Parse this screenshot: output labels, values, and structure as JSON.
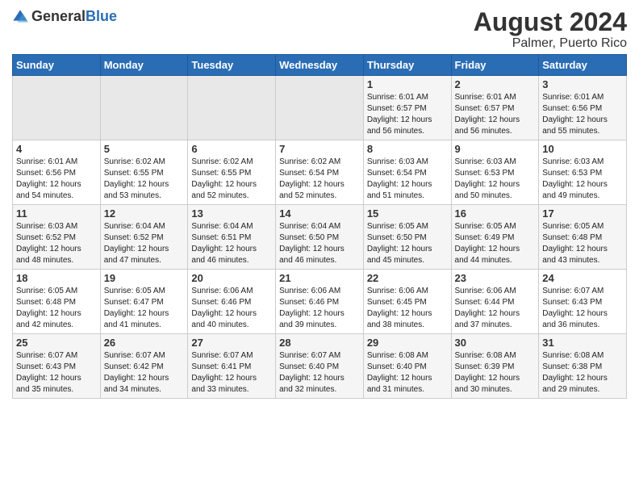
{
  "logo": {
    "general": "General",
    "blue": "Blue"
  },
  "title": "August 2024",
  "subtitle": "Palmer, Puerto Rico",
  "days_header": [
    "Sunday",
    "Monday",
    "Tuesday",
    "Wednesday",
    "Thursday",
    "Friday",
    "Saturday"
  ],
  "weeks": [
    [
      {
        "day": "",
        "sunrise": "",
        "sunset": "",
        "daylight": "",
        "empty": true
      },
      {
        "day": "",
        "sunrise": "",
        "sunset": "",
        "daylight": "",
        "empty": true
      },
      {
        "day": "",
        "sunrise": "",
        "sunset": "",
        "daylight": "",
        "empty": true
      },
      {
        "day": "",
        "sunrise": "",
        "sunset": "",
        "daylight": "",
        "empty": true
      },
      {
        "day": "1",
        "sunrise": "Sunrise: 6:01 AM",
        "sunset": "Sunset: 6:57 PM",
        "daylight": "Daylight: 12 hours and 56 minutes.",
        "empty": false
      },
      {
        "day": "2",
        "sunrise": "Sunrise: 6:01 AM",
        "sunset": "Sunset: 6:57 PM",
        "daylight": "Daylight: 12 hours and 56 minutes.",
        "empty": false
      },
      {
        "day": "3",
        "sunrise": "Sunrise: 6:01 AM",
        "sunset": "Sunset: 6:56 PM",
        "daylight": "Daylight: 12 hours and 55 minutes.",
        "empty": false
      }
    ],
    [
      {
        "day": "4",
        "sunrise": "Sunrise: 6:01 AM",
        "sunset": "Sunset: 6:56 PM",
        "daylight": "Daylight: 12 hours and 54 minutes.",
        "empty": false
      },
      {
        "day": "5",
        "sunrise": "Sunrise: 6:02 AM",
        "sunset": "Sunset: 6:55 PM",
        "daylight": "Daylight: 12 hours and 53 minutes.",
        "empty": false
      },
      {
        "day": "6",
        "sunrise": "Sunrise: 6:02 AM",
        "sunset": "Sunset: 6:55 PM",
        "daylight": "Daylight: 12 hours and 52 minutes.",
        "empty": false
      },
      {
        "day": "7",
        "sunrise": "Sunrise: 6:02 AM",
        "sunset": "Sunset: 6:54 PM",
        "daylight": "Daylight: 12 hours and 52 minutes.",
        "empty": false
      },
      {
        "day": "8",
        "sunrise": "Sunrise: 6:03 AM",
        "sunset": "Sunset: 6:54 PM",
        "daylight": "Daylight: 12 hours and 51 minutes.",
        "empty": false
      },
      {
        "day": "9",
        "sunrise": "Sunrise: 6:03 AM",
        "sunset": "Sunset: 6:53 PM",
        "daylight": "Daylight: 12 hours and 50 minutes.",
        "empty": false
      },
      {
        "day": "10",
        "sunrise": "Sunrise: 6:03 AM",
        "sunset": "Sunset: 6:53 PM",
        "daylight": "Daylight: 12 hours and 49 minutes.",
        "empty": false
      }
    ],
    [
      {
        "day": "11",
        "sunrise": "Sunrise: 6:03 AM",
        "sunset": "Sunset: 6:52 PM",
        "daylight": "Daylight: 12 hours and 48 minutes.",
        "empty": false
      },
      {
        "day": "12",
        "sunrise": "Sunrise: 6:04 AM",
        "sunset": "Sunset: 6:52 PM",
        "daylight": "Daylight: 12 hours and 47 minutes.",
        "empty": false
      },
      {
        "day": "13",
        "sunrise": "Sunrise: 6:04 AM",
        "sunset": "Sunset: 6:51 PM",
        "daylight": "Daylight: 12 hours and 46 minutes.",
        "empty": false
      },
      {
        "day": "14",
        "sunrise": "Sunrise: 6:04 AM",
        "sunset": "Sunset: 6:50 PM",
        "daylight": "Daylight: 12 hours and 46 minutes.",
        "empty": false
      },
      {
        "day": "15",
        "sunrise": "Sunrise: 6:05 AM",
        "sunset": "Sunset: 6:50 PM",
        "daylight": "Daylight: 12 hours and 45 minutes.",
        "empty": false
      },
      {
        "day": "16",
        "sunrise": "Sunrise: 6:05 AM",
        "sunset": "Sunset: 6:49 PM",
        "daylight": "Daylight: 12 hours and 44 minutes.",
        "empty": false
      },
      {
        "day": "17",
        "sunrise": "Sunrise: 6:05 AM",
        "sunset": "Sunset: 6:48 PM",
        "daylight": "Daylight: 12 hours and 43 minutes.",
        "empty": false
      }
    ],
    [
      {
        "day": "18",
        "sunrise": "Sunrise: 6:05 AM",
        "sunset": "Sunset: 6:48 PM",
        "daylight": "Daylight: 12 hours and 42 minutes.",
        "empty": false
      },
      {
        "day": "19",
        "sunrise": "Sunrise: 6:05 AM",
        "sunset": "Sunset: 6:47 PM",
        "daylight": "Daylight: 12 hours and 41 minutes.",
        "empty": false
      },
      {
        "day": "20",
        "sunrise": "Sunrise: 6:06 AM",
        "sunset": "Sunset: 6:46 PM",
        "daylight": "Daylight: 12 hours and 40 minutes.",
        "empty": false
      },
      {
        "day": "21",
        "sunrise": "Sunrise: 6:06 AM",
        "sunset": "Sunset: 6:46 PM",
        "daylight": "Daylight: 12 hours and 39 minutes.",
        "empty": false
      },
      {
        "day": "22",
        "sunrise": "Sunrise: 6:06 AM",
        "sunset": "Sunset: 6:45 PM",
        "daylight": "Daylight: 12 hours and 38 minutes.",
        "empty": false
      },
      {
        "day": "23",
        "sunrise": "Sunrise: 6:06 AM",
        "sunset": "Sunset: 6:44 PM",
        "daylight": "Daylight: 12 hours and 37 minutes.",
        "empty": false
      },
      {
        "day": "24",
        "sunrise": "Sunrise: 6:07 AM",
        "sunset": "Sunset: 6:43 PM",
        "daylight": "Daylight: 12 hours and 36 minutes.",
        "empty": false
      }
    ],
    [
      {
        "day": "25",
        "sunrise": "Sunrise: 6:07 AM",
        "sunset": "Sunset: 6:43 PM",
        "daylight": "Daylight: 12 hours and 35 minutes.",
        "empty": false
      },
      {
        "day": "26",
        "sunrise": "Sunrise: 6:07 AM",
        "sunset": "Sunset: 6:42 PM",
        "daylight": "Daylight: 12 hours and 34 minutes.",
        "empty": false
      },
      {
        "day": "27",
        "sunrise": "Sunrise: 6:07 AM",
        "sunset": "Sunset: 6:41 PM",
        "daylight": "Daylight: 12 hours and 33 minutes.",
        "empty": false
      },
      {
        "day": "28",
        "sunrise": "Sunrise: 6:07 AM",
        "sunset": "Sunset: 6:40 PM",
        "daylight": "Daylight: 12 hours and 32 minutes.",
        "empty": false
      },
      {
        "day": "29",
        "sunrise": "Sunrise: 6:08 AM",
        "sunset": "Sunset: 6:40 PM",
        "daylight": "Daylight: 12 hours and 31 minutes.",
        "empty": false
      },
      {
        "day": "30",
        "sunrise": "Sunrise: 6:08 AM",
        "sunset": "Sunset: 6:39 PM",
        "daylight": "Daylight: 12 hours and 30 minutes.",
        "empty": false
      },
      {
        "day": "31",
        "sunrise": "Sunrise: 6:08 AM",
        "sunset": "Sunset: 6:38 PM",
        "daylight": "Daylight: 12 hours and 29 minutes.",
        "empty": false
      }
    ]
  ]
}
